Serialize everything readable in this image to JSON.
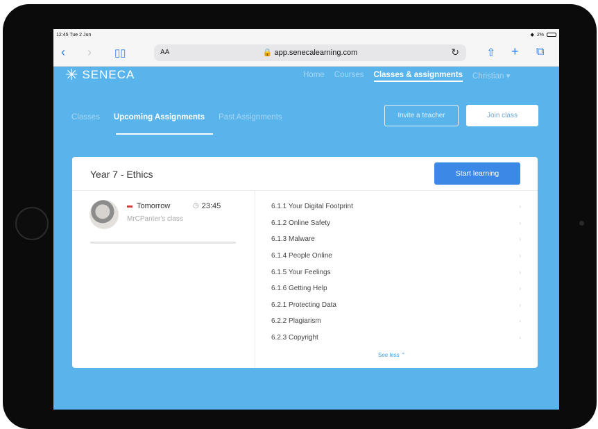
{
  "status_bar": {
    "time": "12:45",
    "date": "Tue 2 Jun",
    "battery": "2%"
  },
  "browser": {
    "url": "app.senecalearning.com",
    "text_size_label": "AA",
    "icons": {
      "back": "chevron-left-icon",
      "forward": "chevron-right-icon",
      "bookmarks": "book-icon",
      "reload": "reload-icon",
      "share": "share-icon",
      "new_tab": "plus-icon",
      "tabs": "tabs-icon"
    }
  },
  "header": {
    "brand": "SENECA",
    "nav": [
      {
        "label": "Home"
      },
      {
        "label": "Courses"
      },
      {
        "label": "Classes & assignments"
      },
      {
        "label": "Christian ▾"
      }
    ]
  },
  "sub_tabs": [
    {
      "label": "Classes"
    },
    {
      "label": "Upcoming Assignments"
    },
    {
      "label": "Past Assignments"
    }
  ],
  "buttons": {
    "invite": "Invite a teacher",
    "join": "Join class"
  },
  "assignment": {
    "title": "Year 7 - Ethics",
    "start_label": "Start learning",
    "due_day": "Tomorrow",
    "due_time": "23:45",
    "class_name": "MrCPanter's class",
    "progress": 0,
    "sections": [
      "6.1.1 Your Digital Footprint",
      "6.1.2 Online Safety",
      "6.1.3 Malware",
      "6.1.4 People Online",
      "6.1.5 Your Feelings",
      "6.1.6 Getting Help",
      "6.2.1 Protecting Data",
      "6.2.2 Plagiarism",
      "6.2.3 Copyright"
    ],
    "see_less": "See less"
  },
  "colors": {
    "brand_blue": "#5ab4ec",
    "button_blue": "#3c88e6",
    "due_red": "#e03a3a"
  }
}
